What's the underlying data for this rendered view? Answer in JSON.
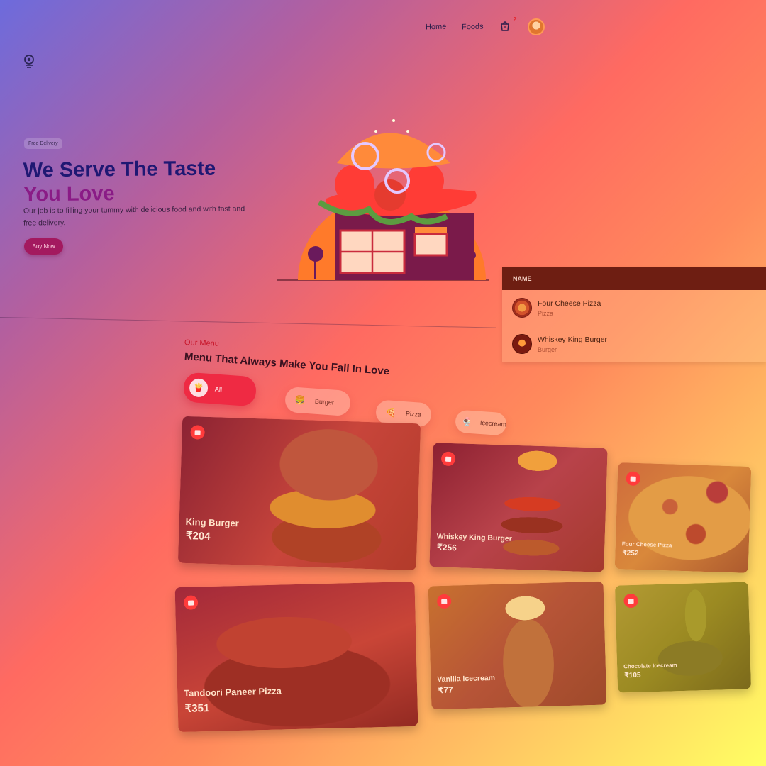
{
  "nav": {
    "home": "Home",
    "foods": "Foods",
    "cart_count": "2"
  },
  "hero": {
    "tag": "Free Delivery",
    "title_line1": "We Serve The Taste",
    "title_line2": "You Love",
    "description": "Our job is to filling your tummy with delicious food and with fast and free delivery.",
    "cta": "Buy Now"
  },
  "name_table": {
    "header": "NAME",
    "rows": [
      {
        "name": "Four Cheese Pizza",
        "category": "Pizza"
      },
      {
        "name": "Whiskey King Burger",
        "category": "Burger"
      }
    ]
  },
  "menu": {
    "subtitle": "Our Menu",
    "title": "Menu That Always Make You Fall In Love",
    "categories": [
      {
        "label": "All",
        "icon": "fast-food-icon",
        "active": true
      },
      {
        "label": "Burger",
        "icon": "burger-icon",
        "active": false
      },
      {
        "label": "Pizza",
        "icon": "pizza-icon",
        "active": false
      },
      {
        "label": "Icecream",
        "icon": "icecream-icon",
        "active": false
      }
    ],
    "items": [
      {
        "name": "King Burger",
        "price": "₹204"
      },
      {
        "name": "Whiskey King Burger",
        "price": "₹256"
      },
      {
        "name": "Four Cheese Pizza",
        "price": "₹252"
      },
      {
        "name": "Tandoori Paneer Pizza",
        "price": "₹351"
      },
      {
        "name": "Vanilla Icecream",
        "price": "₹77"
      },
      {
        "name": "Chocolate Icecream",
        "price": "₹105"
      }
    ]
  },
  "colors": {
    "accent": "#ef2a43",
    "title": "#1f1873",
    "title_highlight": "#8a1b86"
  }
}
